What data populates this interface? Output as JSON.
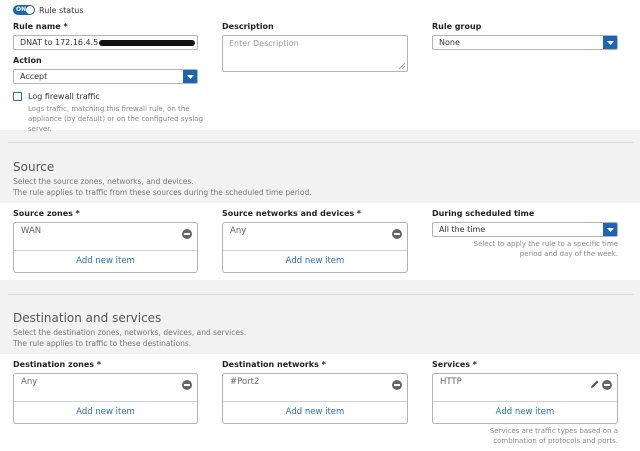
{
  "header": {
    "toggle_label": "ON",
    "rule_status_label": "Rule status",
    "rule_name_label": "Rule name *",
    "rule_name_value": "DNAT to 172.16.4.5 - ",
    "description_label": "Description",
    "description_placeholder": "Enter Description",
    "rule_group_label": "Rule group",
    "rule_group_value": "None",
    "action_label": "Action",
    "action_value": "Accept",
    "log_label": "Log firewall traffic",
    "log_help": "Logs traffic, matching this firewall rule, on the appliance (by default) or on the configured syslog server."
  },
  "source": {
    "title": "Source",
    "subtitle1": "Select the source zones, networks, and devices.",
    "subtitle2": "The rule applies to traffic from these sources during the scheduled time period.",
    "zones_label": "Source zones *",
    "zones_item": "WAN",
    "networks_label": "Source networks and devices *",
    "networks_item": "Any",
    "schedule_label": "During scheduled time",
    "schedule_value": "All the time",
    "schedule_help": "Select to apply the rule to a specific time period and day of the week.",
    "add_new_item": "Add new item"
  },
  "destination": {
    "title": "Destination and services",
    "subtitle1": "Select the destination zones, networks, devices, and services.",
    "subtitle2": "The rule applies to traffic to these destinations.",
    "zones_label": "Destination zones *",
    "zones_item": "Any",
    "networks_label": "Destination networks *",
    "networks_item": "#Port2",
    "services_label": "Services *",
    "services_item": "HTTP",
    "services_help": "Services are traffic types based on a combination of protocols and ports.",
    "add_new_item": "Add new item"
  },
  "colors": {
    "accent": "#1d64b5",
    "link": "#2a6ebb",
    "toggle": "#1d64b5"
  }
}
